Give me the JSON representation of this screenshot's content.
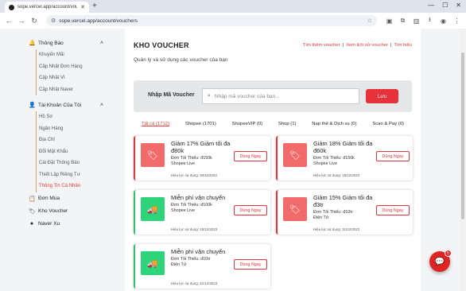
{
  "browser": {
    "tab_title": "sope.vercel.app/account/vouch",
    "url": "sope.vercel.app/account/vouchers",
    "new_tab": "+",
    "win_min": "—",
    "win_max": "☐",
    "win_close": "✕"
  },
  "sidebar": {
    "sections": [
      {
        "icon": "🔔",
        "label": "Thông Báo",
        "expanded": true,
        "items": [
          "Khuyến Mãi",
          "Cập Nhật Đơn Hàng",
          "Cập Nhật Ví",
          "Cập Nhật Naver"
        ]
      },
      {
        "icon": "👤",
        "label": "Tài Khoản Của Tôi",
        "expanded": true,
        "items": [
          "Hồ Sơ",
          "Ngân Hàng",
          "Địa Chỉ",
          "Đổi Mật Khẩu",
          "Cài Đặt Thông Báo",
          "Thiết Lập Riêng Tư",
          "Thông Tin Cá Nhân"
        ]
      },
      {
        "icon": "📋",
        "label": "Đơn Mua"
      },
      {
        "icon": "🏷",
        "label": "Kho Voucher"
      },
      {
        "icon": "●",
        "label": "Naver Xu"
      }
    ]
  },
  "main": {
    "title": "KHO VOUCHER",
    "links": [
      "Tìm thêm voucher",
      "Xem lịch sử voucher",
      "Tìm hiểu"
    ],
    "separator": "|",
    "subtitle": "Quản lý và sử dụng các voucher của bạn",
    "input_label": "Nhập Mã Voucher",
    "input_placeholder": "Nhập mã voucher của bạn...",
    "save_label": "Lưu",
    "tabs": [
      "Tất cả (1712)",
      "Shopee (1701)",
      "ShopeeVIP (0)",
      "Shop (1)",
      "Nạp thẻ & Dịch vụ (0)",
      "Scan & Pay (0)"
    ]
  },
  "vouchers": [
    {
      "kind": "red",
      "name": "Giảm 17% Giảm tối đa đ80k",
      "min": "Đơn Tối Thiểu: đ150k",
      "cat": "Shopee Live",
      "exp": "Hiệu lực sử dụng: 30/11/2023",
      "btn": "Dùng Ngay"
    },
    {
      "kind": "red",
      "name": "Giảm 18% Giảm tối đa đ60k",
      "min": "Đơn Tối Thiểu: đ150k",
      "cat": "Shopee Live",
      "exp": "Hiệu lực sử dụng: 15/12/2023",
      "btn": "Dùng Ngay"
    },
    {
      "kind": "green",
      "name": "Miễn phí vận chuyển",
      "min": "Đơn Tối Thiểu: đ100k",
      "cat": "Shopee Live",
      "exp": "Hiệu lực sử dụng: 15/12/2023",
      "btn": "Dùng Ngay"
    },
    {
      "kind": "red",
      "name": "Giảm 15% Giảm tối đa đ3tr",
      "min": "Đơn Tối Thiểu: đ10tr",
      "cat": "Điện Tử",
      "exp": "Hiệu lực sử dụng: 31/12/2023",
      "btn": "Dùng Ngay"
    },
    {
      "kind": "green",
      "name": "Miễn phí vận chuyển",
      "min": "Đơn Tối Thiểu: đ10tr",
      "cat": "Điện Tử",
      "exp": "Hiệu lực sử dụng: 31/12/2023",
      "btn": "Dùng Ngay"
    }
  ],
  "chat": {
    "count": "5"
  },
  "colors": {
    "accent": "#e8323a",
    "green": "#2ec36b",
    "sidebar_active": "#e53935"
  }
}
